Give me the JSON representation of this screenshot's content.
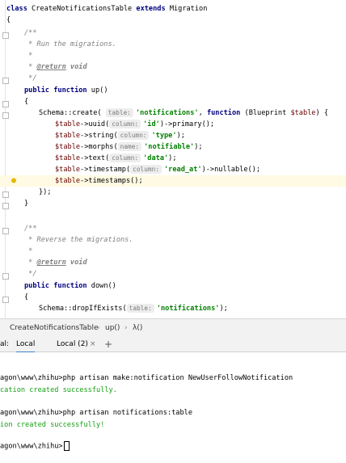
{
  "code": {
    "l1_kw1": "class ",
    "l1_name": "CreateNotificationsTable ",
    "l1_kw2": "extends ",
    "l1_parent": "Migration",
    "l2": "{",
    "c1_open": "/**",
    "c1_text": " * Run the migrations.",
    "c1_star": " *",
    "c1_tag": "@return",
    "c1_void": " void",
    "c1_close": " */",
    "up_kw1": "public ",
    "up_kw2": "function ",
    "up_name": "up()",
    "brace_open": "{",
    "schema_create": "Schema::create(",
    "hint_table": "table:",
    "str_notifications": "'notifications'",
    "comma_function": ", ",
    "kw_function": "function ",
    "blueprint": "(Blueprint ",
    "var_table": "$table",
    "closing": ") {",
    "r1_var": "$table",
    "r1_call": "->uuid(",
    "r1_hint": "column:",
    "r1_str": "'id'",
    "r1_rest": ")->primary();",
    "r2_var": "$table",
    "r2_call": "->string(",
    "r2_hint": "column:",
    "r2_str": "'type'",
    "r2_rest": ");",
    "r3_var": "$table",
    "r3_call": "->morphs(",
    "r3_hint": "name:",
    "r3_str": "'notifiable'",
    "r3_rest": ");",
    "r4_var": "$table",
    "r4_call": "->text(",
    "r4_hint": "column:",
    "r4_str": "'data'",
    "r4_rest": ");",
    "r5_var": "$table",
    "r5_call": "->timestamp(",
    "r5_hint": "column:",
    "r5_str": "'read_at'",
    "r5_rest": ")->nullable();",
    "r6_var": "$table",
    "r6_call": "->timestamps();",
    "close_closure": "});",
    "brace_close": "}",
    "c2_open": "/**",
    "c2_text": " * Reverse the migrations.",
    "c2_star": " *",
    "c2_tag": "@return",
    "c2_void": " void",
    "c2_close": " */",
    "down_kw1": "public ",
    "down_kw2": "function ",
    "down_name": "down()",
    "brace_open2": "{",
    "drop_call": "Schema::dropIfExists(",
    "drop_hint": "table:",
    "drop_str": "'notifications'",
    "drop_rest": ");"
  },
  "breadcrumb": {
    "class": "CreateNotificationsTable",
    "sep": "›",
    "method": "up()",
    "closure": "λ()"
  },
  "terminal_tabs": {
    "prefix": "al:",
    "tab1": "Local",
    "tab2": "Local (2)",
    "close": "×",
    "add": "+"
  },
  "terminal": {
    "l1_prompt": "agon\\www\\zhihu>",
    "l1_cmd": "php artisan make:notification NewUserFollowNotification",
    "l2": "cation created successfully.",
    "l3_prompt": "agon\\www\\zhihu>",
    "l3_cmd": "php artisan notifications:table",
    "l4": "ion created successfully!",
    "l5_prompt": "agon\\www\\zhihu>"
  },
  "colors": {
    "keyword": "#000080",
    "string": "#008000",
    "success": "#15a015",
    "caret_line": "#fffae3"
  }
}
